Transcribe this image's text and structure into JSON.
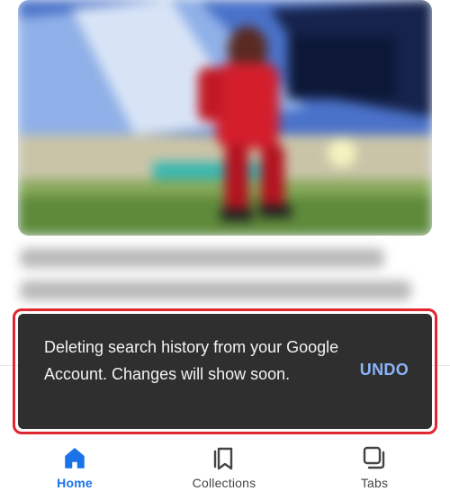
{
  "snackbar": {
    "message": "Deleting search history from your Google Account. Changes will show soon.",
    "action_label": "UNDO",
    "action_color": "#8ab4f8",
    "highlight_color": "#e0262e"
  },
  "bottom_nav": {
    "items": [
      {
        "label": "Home",
        "icon": "home-icon",
        "active": true
      },
      {
        "label": "Collections",
        "icon": "bookmarks-icon",
        "active": false
      },
      {
        "label": "Tabs",
        "icon": "tabs-icon",
        "active": false
      }
    ],
    "active_color": "#1a73e8"
  }
}
